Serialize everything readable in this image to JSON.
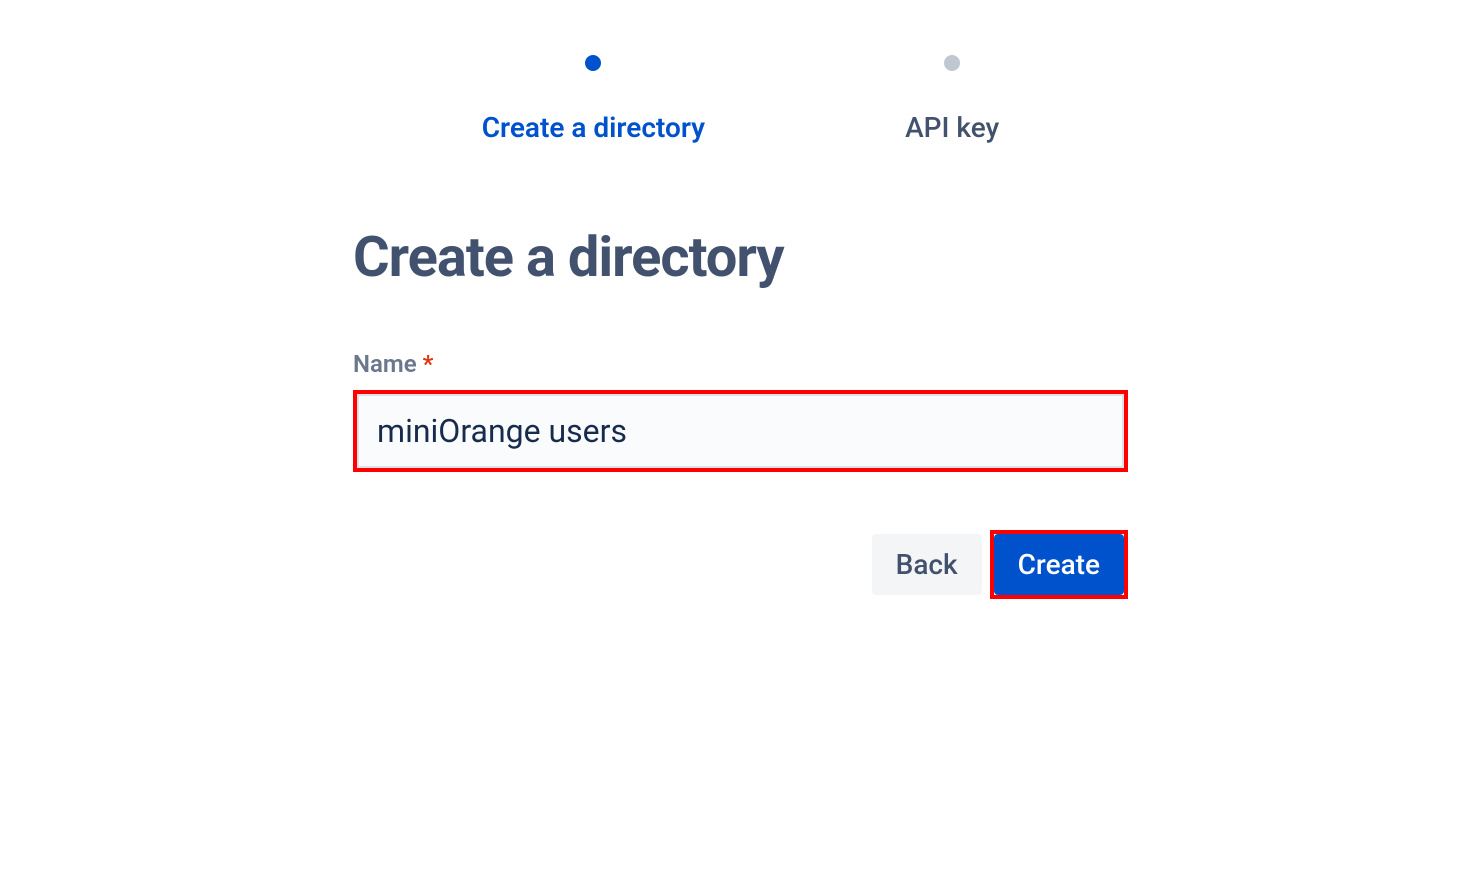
{
  "stepper": {
    "steps": [
      {
        "label": "Create a directory",
        "active": true
      },
      {
        "label": "API key",
        "active": false
      }
    ]
  },
  "page": {
    "title": "Create a directory"
  },
  "form": {
    "name_label": "Name",
    "name_value": "miniOrange users"
  },
  "buttons": {
    "back": "Back",
    "create": "Create"
  }
}
